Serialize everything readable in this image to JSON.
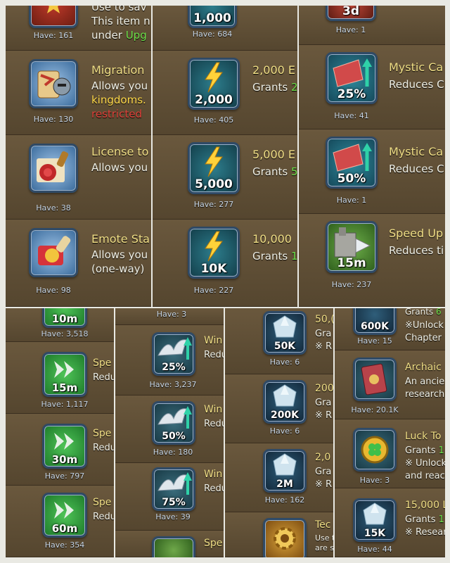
{
  "p1": {
    "r0": {
      "desc1": "Use to sav",
      "desc2": "This item n",
      "desc3a": "under ",
      "desc3b": "Upg",
      "have": "Have: 161"
    },
    "r1": {
      "title": "Migration",
      "desc1": "Allows you",
      "desc2": "kingdoms.",
      "desc3": "restricted",
      "have": "Have: 130"
    },
    "r2": {
      "title": "License to",
      "desc1": "Allows you",
      "have": "Have: 38"
    },
    "r3": {
      "title": "Emote Sta",
      "desc1": "Allows you",
      "desc2": "(one-way)",
      "have": "Have: 98"
    }
  },
  "p2": {
    "r0": {
      "qty": "1,000",
      "have": "Have: 684"
    },
    "r1": {
      "qty": "2,000",
      "title": "2,000 E",
      "desc1": "Grants ",
      "desc1g": "2",
      "have": "Have: 405"
    },
    "r2": {
      "qty": "5,000",
      "title": "5,000 E",
      "desc1": "Grants ",
      "desc1g": "5",
      "have": "Have: 277"
    },
    "r3": {
      "qty": "10K",
      "title": "10,000",
      "desc1": "Grants ",
      "desc1g": "1",
      "have": "Have: 227"
    }
  },
  "p3": {
    "r0": {
      "qty": "3d",
      "have": "Have: 1"
    },
    "r1": {
      "qty": "25%",
      "title": "Mystic Ca",
      "desc1": "Reduces C",
      "have": "Have: 41"
    },
    "r2": {
      "qty": "50%",
      "title": "Mystic Ca",
      "desc1": "Reduces C",
      "have": "Have: 1"
    },
    "r3": {
      "qty": "15m",
      "title": "Speed Up",
      "desc1": "Reduces ti",
      "have": "Have: 237"
    }
  },
  "p4": {
    "r0": {
      "qty": "10m",
      "have": "Have: 3,518"
    },
    "r1": {
      "qty": "15m",
      "title": "Spe",
      "desc1": "Redu",
      "have": "Have: 1,117"
    },
    "r2": {
      "qty": "30m",
      "title": "Spe",
      "desc1": "Redu",
      "have": "Have: 797"
    },
    "r3": {
      "qty": "60m",
      "title": "Spe",
      "desc1": "Redu",
      "have": "Have: 354"
    }
  },
  "p5": {
    "r0": {
      "have": "Have: 3"
    },
    "r1": {
      "qty": "25%",
      "title": "Win",
      "desc1": "Redu",
      "have": "Have: 3,237"
    },
    "r2": {
      "qty": "50%",
      "title": "Win",
      "desc1": "Redu",
      "have": "Have: 180"
    },
    "r3": {
      "qty": "75%",
      "title": "Win",
      "desc1": "Redu",
      "have": "Have: 39"
    },
    "r4": {
      "title": "Spe"
    }
  },
  "p6": {
    "r0": {
      "qty": "50K",
      "title": "50,(",
      "desc1": "Gra",
      "desc2": "※ R",
      "have": "Have: 6"
    },
    "r1": {
      "qty": "200K",
      "title": "200",
      "desc1": "Gra",
      "desc2": "※ R",
      "have": "Have: 6"
    },
    "r2": {
      "qty": "2M",
      "title": "2,0",
      "desc1": "Gra",
      "desc2": "※ R",
      "have": "Have: 162"
    },
    "r3": {
      "title": "Tec",
      "desc1": "Use t",
      "desc2": "are s"
    }
  },
  "p7": {
    "r0": {
      "qty": "600K",
      "desc0a": "Grants ",
      "desc0b": "6",
      "desc1": "※Unlock",
      "desc2": "Chapter",
      "have": "Have: 15"
    },
    "r1": {
      "title": "Archaic",
      "desc1": "An ancie",
      "desc2": "research",
      "have": "Have: 20.1K"
    },
    "r2": {
      "title": "Luck To",
      "desc1": "Grants ",
      "desc1g": "1",
      "desc2": "※ Unlock",
      "desc3": "and reac",
      "have": "Have: 3"
    },
    "r3": {
      "qty": "15K",
      "title": "15,000 L",
      "desc1": "Grants ",
      "desc1g": "1",
      "desc2": "※ Resear",
      "have": "Have: 44"
    }
  },
  "colors": {
    "panel": "#5a4b34",
    "title": "#f1df86",
    "green": "#6de04a",
    "have": "#c9d7e6"
  }
}
